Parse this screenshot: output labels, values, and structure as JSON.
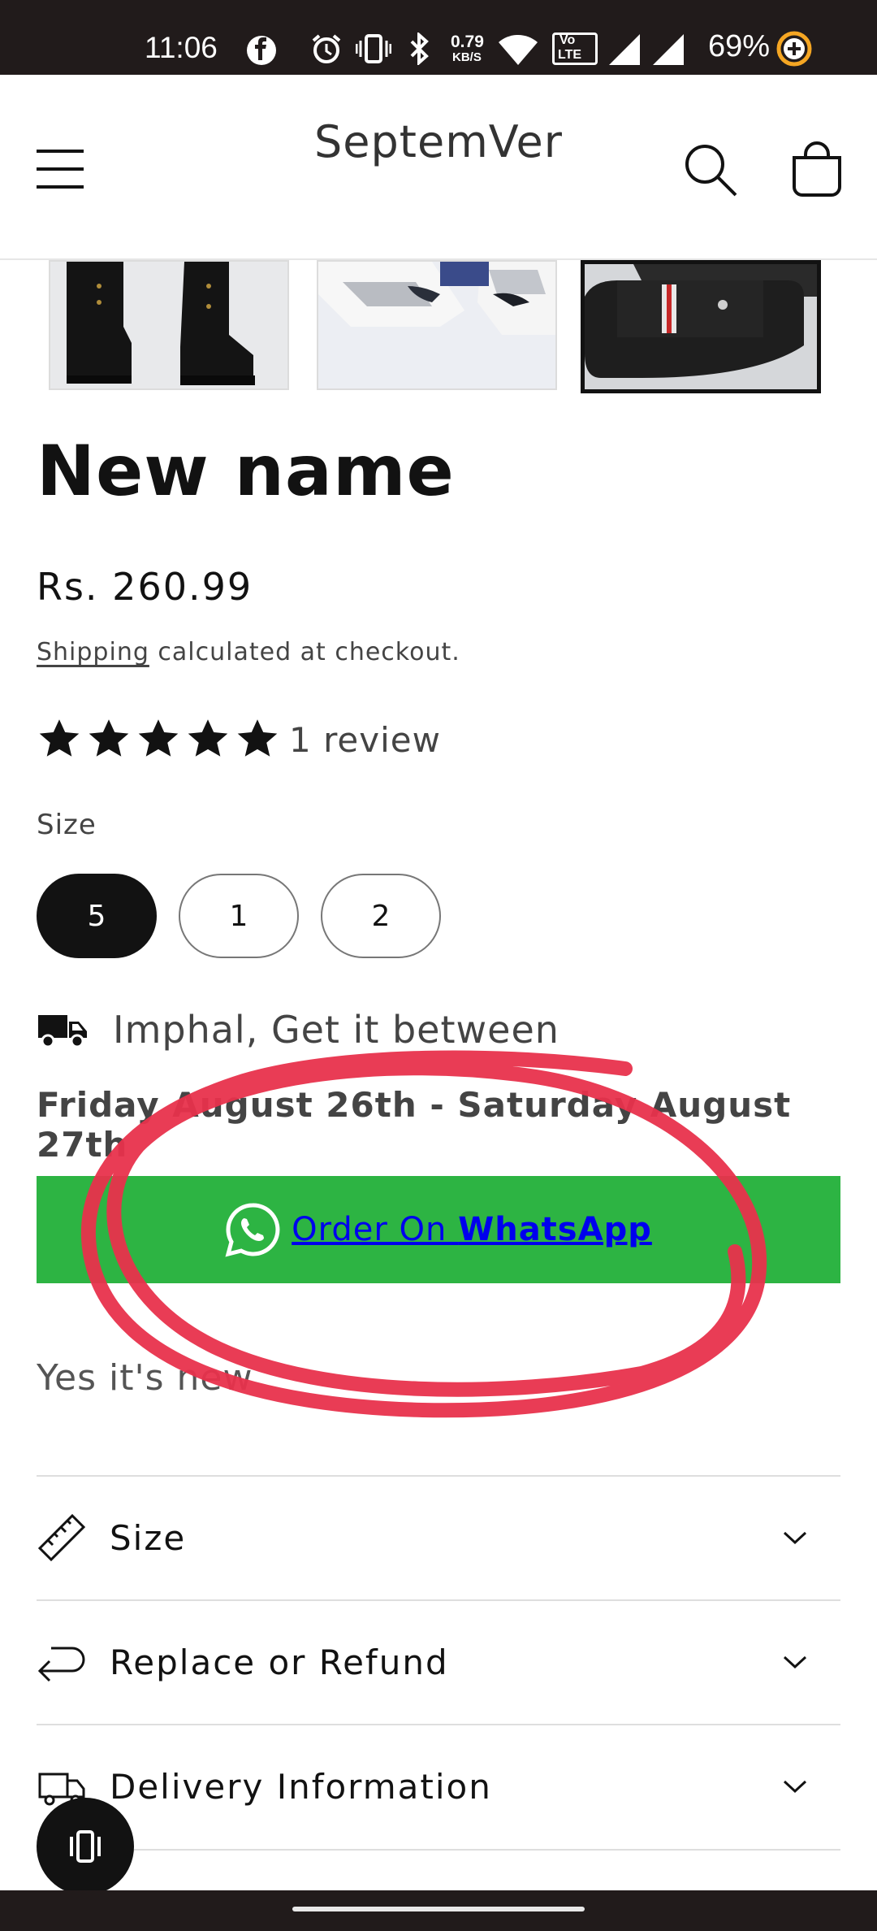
{
  "status_bar": {
    "time": "11:06",
    "net_speed_value": "0.79",
    "net_speed_unit": "KB/S",
    "volte_top": "Vo",
    "volte_bottom": "LTE",
    "battery": "69%"
  },
  "header": {
    "store_name": "SeptemVer",
    "menu_icon": "hamburger-menu-icon",
    "search_icon": "search-icon",
    "cart_icon": "shopping-bag-icon"
  },
  "gallery": {
    "thumbnails": [
      "black boots",
      "white sneakers",
      "black slides"
    ],
    "selected_index": 2
  },
  "product": {
    "title": "New name",
    "price": "Rs. 260.99",
    "shipping_link": "Shipping",
    "shipping_text": " calculated at checkout.",
    "rating": 5,
    "review_count": "1 review"
  },
  "size_picker": {
    "label": "Size",
    "options": [
      "5",
      "1",
      "2"
    ],
    "selected": "5"
  },
  "delivery": {
    "location_text": "Imphal, Get it between",
    "dates": "Friday August 26th - Saturday August 27th"
  },
  "whatsapp": {
    "label_prefix": "Order On ",
    "label_brand": "WhatsApp",
    "color": "#2db443"
  },
  "description": "Yes it's new",
  "accordion": [
    {
      "label": "Size",
      "icon": "ruler-icon"
    },
    {
      "label": "Replace or Refund",
      "icon": "return-arrow-icon"
    },
    {
      "label": "Delivery Information",
      "icon": "truck-icon"
    }
  ],
  "annotation_color": "#e8324c"
}
